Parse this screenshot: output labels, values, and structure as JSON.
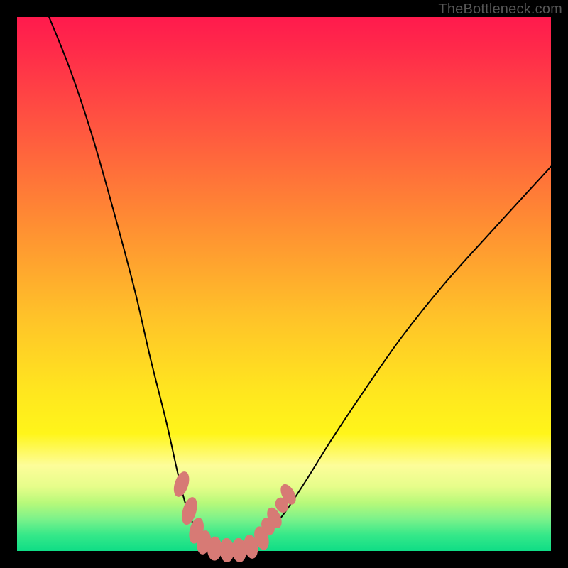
{
  "watermark": "TheBottleneck.com",
  "chart_data": {
    "type": "line",
    "title": "",
    "xlabel": "",
    "ylabel": "",
    "xlim": [
      0,
      100
    ],
    "ylim": [
      0,
      100
    ],
    "series": [
      {
        "name": "left-curve",
        "x": [
          6,
          10,
          14,
          18,
          22,
          25,
          28,
          30,
          31.5,
          33,
          34.5,
          36,
          37.5,
          39,
          41
        ],
        "y": [
          100,
          90,
          78,
          64,
          49,
          36,
          24,
          15,
          9,
          5,
          2.5,
          1.2,
          0.5,
          0.2,
          0.1
        ]
      },
      {
        "name": "right-curve",
        "x": [
          41,
          43,
          45,
          47,
          50,
          54,
          59,
          65,
          72,
          80,
          89,
          100
        ],
        "y": [
          0.1,
          0.5,
          1.5,
          3.5,
          7,
          13,
          21,
          30,
          40,
          50,
          60,
          72
        ]
      }
    ],
    "markers": [
      {
        "cx": 30.8,
        "cy": 12.5,
        "rx": 1.2,
        "ry": 2.4,
        "rot": 18
      },
      {
        "cx": 32.3,
        "cy": 7.5,
        "rx": 1.2,
        "ry": 2.6,
        "rot": 16
      },
      {
        "cx": 33.6,
        "cy": 3.8,
        "rx": 1.2,
        "ry": 2.4,
        "rot": 14
      },
      {
        "cx": 35.0,
        "cy": 1.6,
        "rx": 1.2,
        "ry": 2.2,
        "rot": 10
      },
      {
        "cx": 37.0,
        "cy": 0.45,
        "rx": 1.3,
        "ry": 2.2,
        "rot": 2
      },
      {
        "cx": 39.3,
        "cy": 0.15,
        "rx": 1.3,
        "ry": 2.2,
        "rot": -2
      },
      {
        "cx": 41.6,
        "cy": 0.15,
        "rx": 1.3,
        "ry": 2.2,
        "rot": -4
      },
      {
        "cx": 43.8,
        "cy": 0.8,
        "rx": 1.2,
        "ry": 2.2,
        "rot": -10
      },
      {
        "cx": 45.8,
        "cy": 2.4,
        "rx": 1.2,
        "ry": 2.2,
        "rot": -16
      },
      {
        "cx": 47.0,
        "cy": 4.6,
        "rx": 1.1,
        "ry": 1.6,
        "rot": -22
      },
      {
        "cx": 48.2,
        "cy": 6.2,
        "rx": 1.1,
        "ry": 2.0,
        "rot": -24
      },
      {
        "cx": 49.6,
        "cy": 8.6,
        "rx": 1.1,
        "ry": 1.4,
        "rot": -26
      },
      {
        "cx": 50.8,
        "cy": 10.6,
        "rx": 1.1,
        "ry": 2.0,
        "rot": -28
      }
    ],
    "gradient_stops": [
      {
        "pos": 0,
        "color": "#ff1a4d"
      },
      {
        "pos": 22,
        "color": "#ff5a3f"
      },
      {
        "pos": 56,
        "color": "#ffc229"
      },
      {
        "pos": 78,
        "color": "#fff51a"
      },
      {
        "pos": 100,
        "color": "#0fdd86"
      }
    ]
  }
}
